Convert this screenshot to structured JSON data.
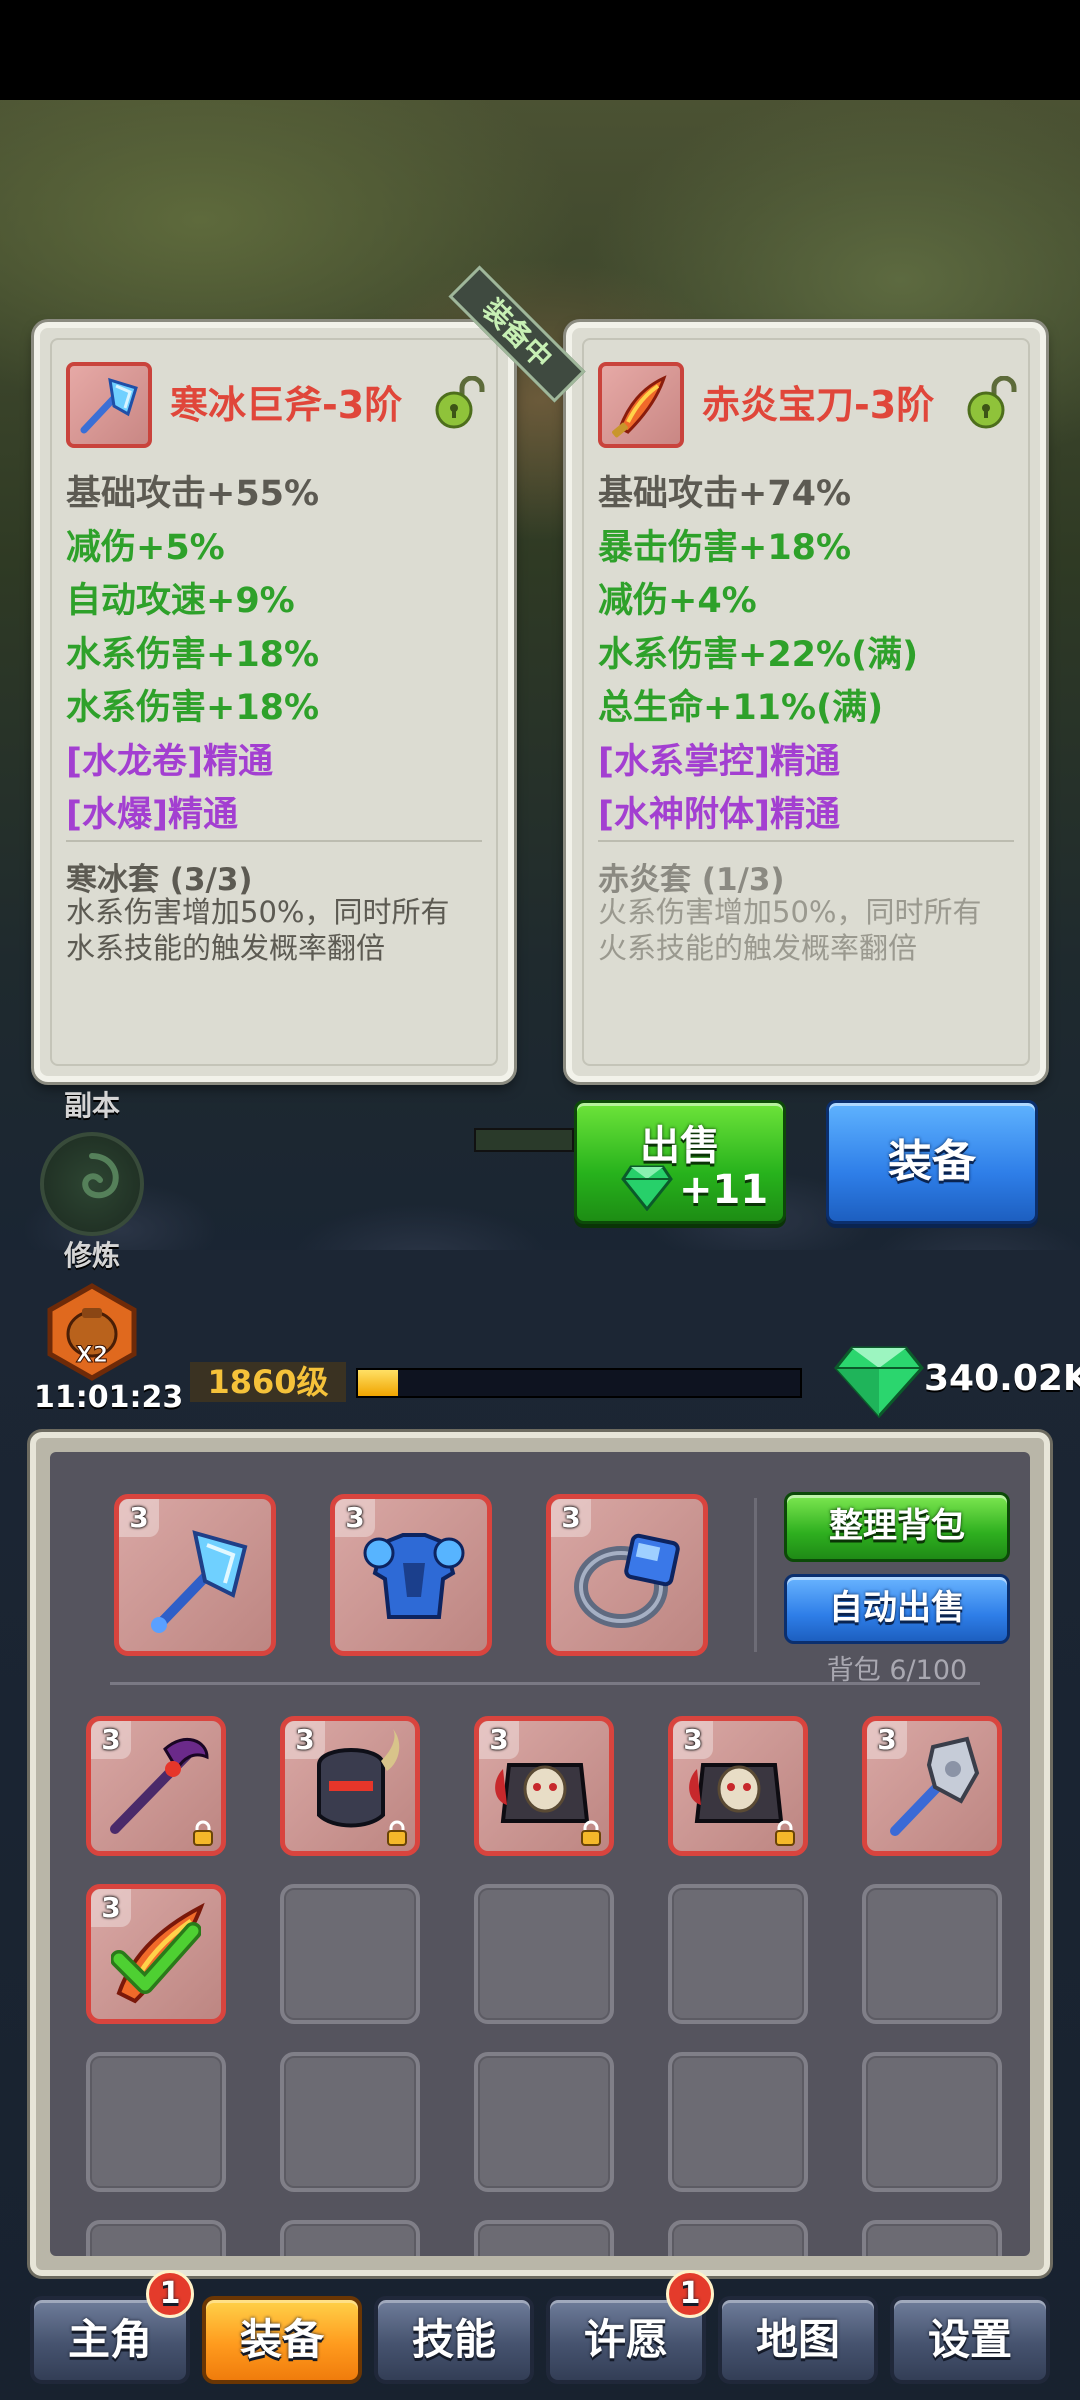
{
  "compare": {
    "equipped_tag": "装备中",
    "left": {
      "title": "寒冰巨斧-3阶",
      "stats": [
        {
          "text": "基础攻击+55%",
          "color": "base"
        },
        {
          "text": "减伤+5%",
          "color": "green"
        },
        {
          "text": "自动攻速+9%",
          "color": "green"
        },
        {
          "text": "水系伤害+18%",
          "color": "green"
        },
        {
          "text": "水系伤害+18%",
          "color": "green"
        },
        {
          "text": "[水龙卷]精通",
          "color": "purple"
        },
        {
          "text": "[水爆]精通",
          "color": "purple"
        }
      ],
      "set_name": "寒冰套 (3/3)",
      "set_desc": "水系伤害增加50%，同时所有水系技能的触发概率翻倍",
      "icon": "ice-axe-icon"
    },
    "right": {
      "title": "赤炎宝刀-3阶",
      "stats": [
        {
          "text": "基础攻击+74%",
          "color": "base"
        },
        {
          "text": "暴击伤害+18%",
          "color": "green"
        },
        {
          "text": "减伤+4%",
          "color": "green"
        },
        {
          "text": "水系伤害+22%(满)",
          "color": "green"
        },
        {
          "text": "总生命+11%(满)",
          "color": "green"
        },
        {
          "text": "[水系掌控]精通",
          "color": "purple"
        },
        {
          "text": "[水神附体]精通",
          "color": "purple"
        }
      ],
      "set_name": "赤炎套 (1/3)",
      "set_desc": "火系伤害增加50%，同时所有火系技能的触发概率翻倍",
      "icon": "fire-blade-icon"
    }
  },
  "hud": {
    "dungeon_label": "副本",
    "cultivate_label": "修炼",
    "bag_badge": "X2",
    "timer": "11:01:23",
    "level": "1860级",
    "xp_progress": 0.09,
    "gems": "340.02K"
  },
  "actions": {
    "sell_label": "出售",
    "sell_price": "+11",
    "equip_label": "装备"
  },
  "inventory": {
    "sort_label": "整理背包",
    "autosell_label": "自动出售",
    "bag_count": "背包 6/100",
    "equipped": [
      {
        "level": "3",
        "icon": "ice-axe-icon"
      },
      {
        "level": "3",
        "icon": "blue-armor-icon"
      },
      {
        "level": "3",
        "icon": "sapphire-ring-icon"
      }
    ],
    "items": [
      {
        "level": "3",
        "icon": "dark-scythe-icon",
        "locked": true
      },
      {
        "level": "3",
        "icon": "horned-helmet-icon",
        "locked": true
      },
      {
        "level": "3",
        "icon": "skull-armor-icon",
        "locked": true
      },
      {
        "level": "3",
        "icon": "skull-armor-icon",
        "locked": true
      },
      {
        "level": "3",
        "icon": "silver-mace-icon",
        "locked": false
      },
      {
        "level": "3",
        "icon": "fire-blade-icon",
        "locked": false,
        "checked": true
      }
    ]
  },
  "nav": {
    "tabs": [
      {
        "label": "主角",
        "badge": "1"
      },
      {
        "label": "装备",
        "active": true
      },
      {
        "label": "技能"
      },
      {
        "label": "许愿",
        "badge": "1"
      },
      {
        "label": "地图"
      },
      {
        "label": "设置"
      }
    ]
  },
  "colors": {
    "title_red": "#e0463a",
    "stat_green": "#2ea12a",
    "stat_purple": "#a33fd1",
    "active_tab": "#ff9b1e"
  }
}
